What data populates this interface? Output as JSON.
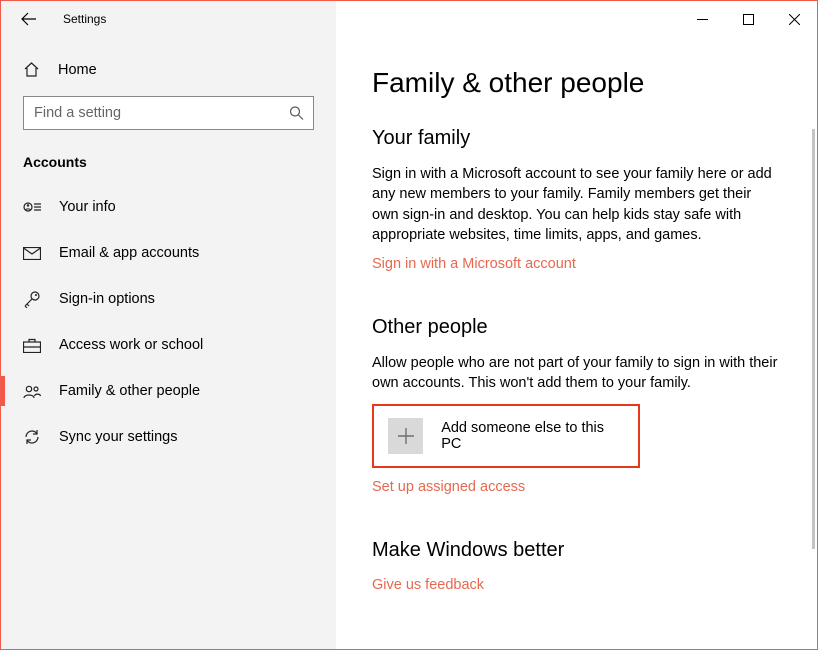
{
  "titlebar": {
    "title": "Settings"
  },
  "sidebar": {
    "home": "Home",
    "search_placeholder": "Find a setting",
    "section_label": "Accounts",
    "items": [
      {
        "label": "Your info"
      },
      {
        "label": "Email & app accounts"
      },
      {
        "label": "Sign-in options"
      },
      {
        "label": "Access work or school"
      },
      {
        "label": "Family & other people"
      },
      {
        "label": "Sync your settings"
      }
    ]
  },
  "content": {
    "page_title": "Family & other people",
    "family": {
      "heading": "Your family",
      "body": "Sign in with a Microsoft account to see your family here or add any new members to your family. Family members get their own sign-in and desktop. You can help kids stay safe with appropriate websites, time limits, apps, and games.",
      "link": "Sign in with a Microsoft account"
    },
    "other": {
      "heading": "Other people",
      "body": "Allow people who are not part of your family to sign in with their own accounts. This won't add them to your family.",
      "add_label": "Add someone else to this PC",
      "assigned_link": "Set up assigned access"
    },
    "feedback": {
      "heading": "Make Windows better",
      "link": "Give us feedback"
    }
  }
}
